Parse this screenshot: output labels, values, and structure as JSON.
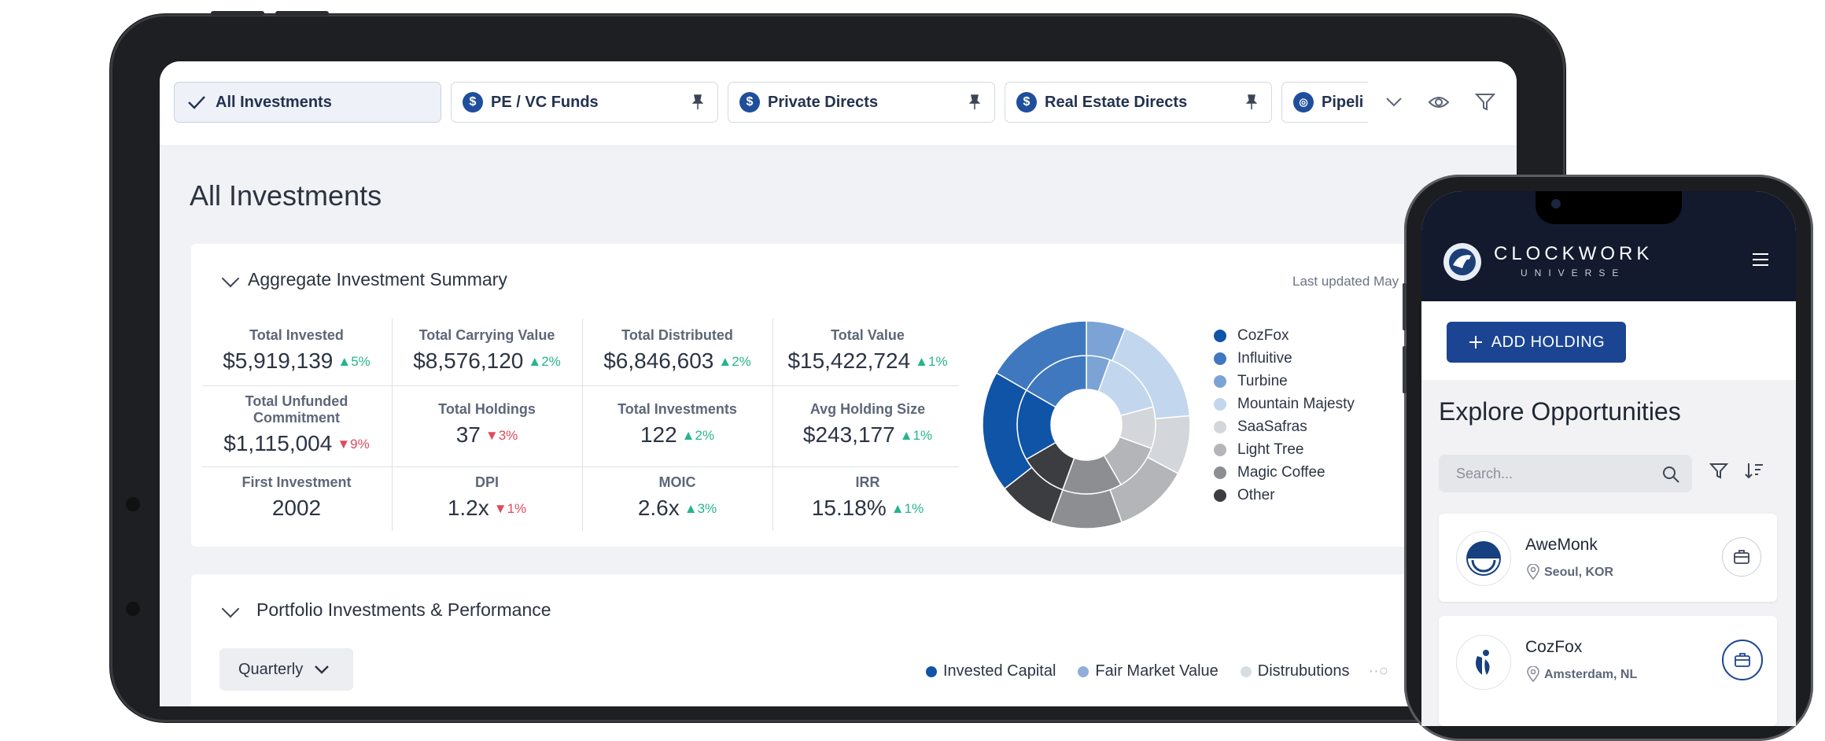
{
  "tabs": [
    {
      "label": "All Investments",
      "icon": "check-icon",
      "active": true
    },
    {
      "label": "PE / VC Funds",
      "icon": "dollar-icon"
    },
    {
      "label": "Private Directs",
      "icon": "dollar-icon"
    },
    {
      "label": "Real Estate Directs",
      "icon": "dollar-icon"
    },
    {
      "label": "Pipeli",
      "icon": "binoculars-icon"
    }
  ],
  "page_title": "All Investments",
  "summary": {
    "title": "Aggregate Investment Summary",
    "last_updated": "Last updated May",
    "metrics": [
      {
        "label": "Total Invested",
        "value": "$5,919,139",
        "delta": "5%",
        "dir": "up"
      },
      {
        "label": "Total Carrying Value",
        "value": "$8,576,120",
        "delta": "2%",
        "dir": "up"
      },
      {
        "label": "Total Distributed",
        "value": "$6,846,603",
        "delta": "2%",
        "dir": "up"
      },
      {
        "label": "Total Value",
        "value": "$15,422,724",
        "delta": "1%",
        "dir": "up"
      },
      {
        "label": "Total Unfunded Commitment",
        "value": "$1,115,004",
        "delta": "9%",
        "dir": "down"
      },
      {
        "label": "Total Holdings",
        "value": "37",
        "delta": "3%",
        "dir": "down"
      },
      {
        "label": "Total Investments",
        "value": "122",
        "delta": "2%",
        "dir": "up"
      },
      {
        "label": "Avg Holding Size",
        "value": "$243,177",
        "delta": "1%",
        "dir": "up"
      },
      {
        "label": "First Investment",
        "value": "2002",
        "delta": "",
        "dir": ""
      },
      {
        "label": "DPI",
        "value": "1.2x",
        "delta": "1%",
        "dir": "down"
      },
      {
        "label": "MOIC",
        "value": "2.6x",
        "delta": "3%",
        "dir": "up"
      },
      {
        "label": "IRR",
        "value": "15.18%",
        "delta": "1%",
        "dir": "up"
      }
    ],
    "legend": [
      {
        "label": "CozFox",
        "color": "#1054a8"
      },
      {
        "label": "Influitive",
        "color": "#3f78bf"
      },
      {
        "label": "Turbine",
        "color": "#7ba3d6"
      },
      {
        "label": "Mountain Majesty",
        "color": "#c2d6ee"
      },
      {
        "label": "SaaSafras",
        "color": "#d3d6da"
      },
      {
        "label": "Light Tree",
        "color": "#b3b5b8"
      },
      {
        "label": "Magic Coffee",
        "color": "#8c8e91"
      },
      {
        "label": "Other",
        "color": "#3b3d40"
      }
    ]
  },
  "portfolio": {
    "title": "Portfolio Investments & Performance",
    "period_select": "Quarterly",
    "legend": [
      {
        "label": "Invested Capital",
        "color": "#1054a8"
      },
      {
        "label": "Fair Market Value",
        "color": "#8faedb"
      },
      {
        "label": "Distrubutions",
        "color": "#d8dde5"
      }
    ]
  },
  "mobile": {
    "brand_name": "CLOCKWORK",
    "brand_sub": "UNIVERSE",
    "add_button": "ADD HOLDING",
    "explore_title": "Explore Opportunities",
    "search_placeholder": "Search...",
    "items": [
      {
        "name": "AweMonk",
        "location": "Seoul, KOR"
      },
      {
        "name": "CozFox",
        "location": "Amsterdam, NL"
      }
    ]
  }
}
